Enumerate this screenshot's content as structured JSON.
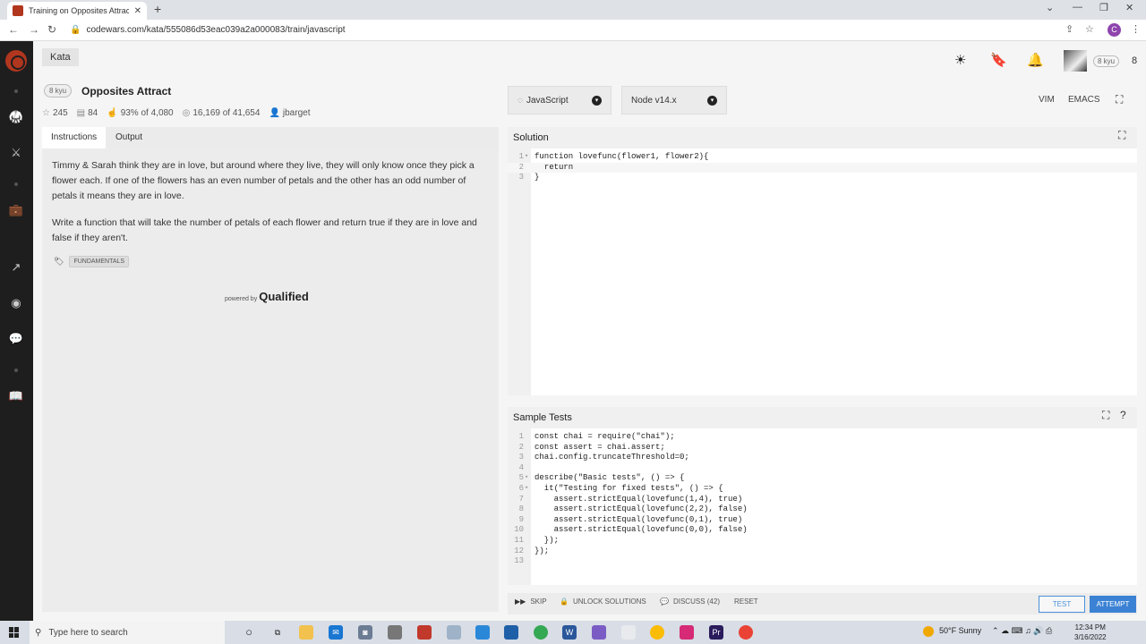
{
  "browser": {
    "tab_title": "Training on Opposites Attract | C",
    "url": "codewars.com/kata/555086d53eac039a2a000083/train/javascript",
    "profile_initial": "C"
  },
  "header": {
    "kata_tab": "Kata",
    "rank_badge": "8 kyu",
    "honor": "8"
  },
  "kata": {
    "rank": "8 kyu",
    "title": "Opposites Attract",
    "stats": {
      "stars": "245",
      "collections": "84",
      "satisfaction": "93% of 4,080",
      "completions": "16,169 of 41,654",
      "author": "jbarget"
    }
  },
  "instructions": {
    "tabs": [
      "Instructions",
      "Output"
    ],
    "paragraphs": [
      "Timmy & Sarah think they are in love, but around where they live, they will only know once they pick a flower each. If one of the flowers has an even number of petals and the other has an odd number of petals it means they are in love.",
      "Write a function that will take the number of petals of each flower and return true if they are in love and false if they aren't."
    ],
    "tag": "FUNDAMENTALS",
    "powered_by": "powered by",
    "brand": "Qualified"
  },
  "editor_controls": {
    "language": "JavaScript",
    "runtime": "Node v14.x",
    "modes": [
      "VIM",
      "EMACS"
    ]
  },
  "solution": {
    "title": "Solution",
    "lines": [
      "function lovefunc(flower1, flower2){",
      "  return",
      "}"
    ]
  },
  "tests": {
    "title": "Sample Tests",
    "lines": [
      "const chai = require(\"chai\");",
      "const assert = chai.assert;",
      "chai.config.truncateThreshold=0;",
      "",
      "describe(\"Basic tests\", () => {",
      "  it(\"Testing for fixed tests\", () => {",
      "    assert.strictEqual(lovefunc(1,4), true)",
      "    assert.strictEqual(lovefunc(2,2), false)",
      "    assert.strictEqual(lovefunc(0,1), true)",
      "    assert.strictEqual(lovefunc(0,0), false)",
      "  });",
      "});",
      ""
    ]
  },
  "actions": {
    "skip": "SKIP",
    "unlock": "UNLOCK SOLUTIONS",
    "discuss": "DISCUSS (42)",
    "reset": "RESET",
    "test": "TEST",
    "attempt": "ATTEMPT"
  },
  "taskbar": {
    "search_placeholder": "Type here to search",
    "weather": "50°F  Sunny",
    "time": "12:34 PM",
    "date": "3/16/2022"
  }
}
